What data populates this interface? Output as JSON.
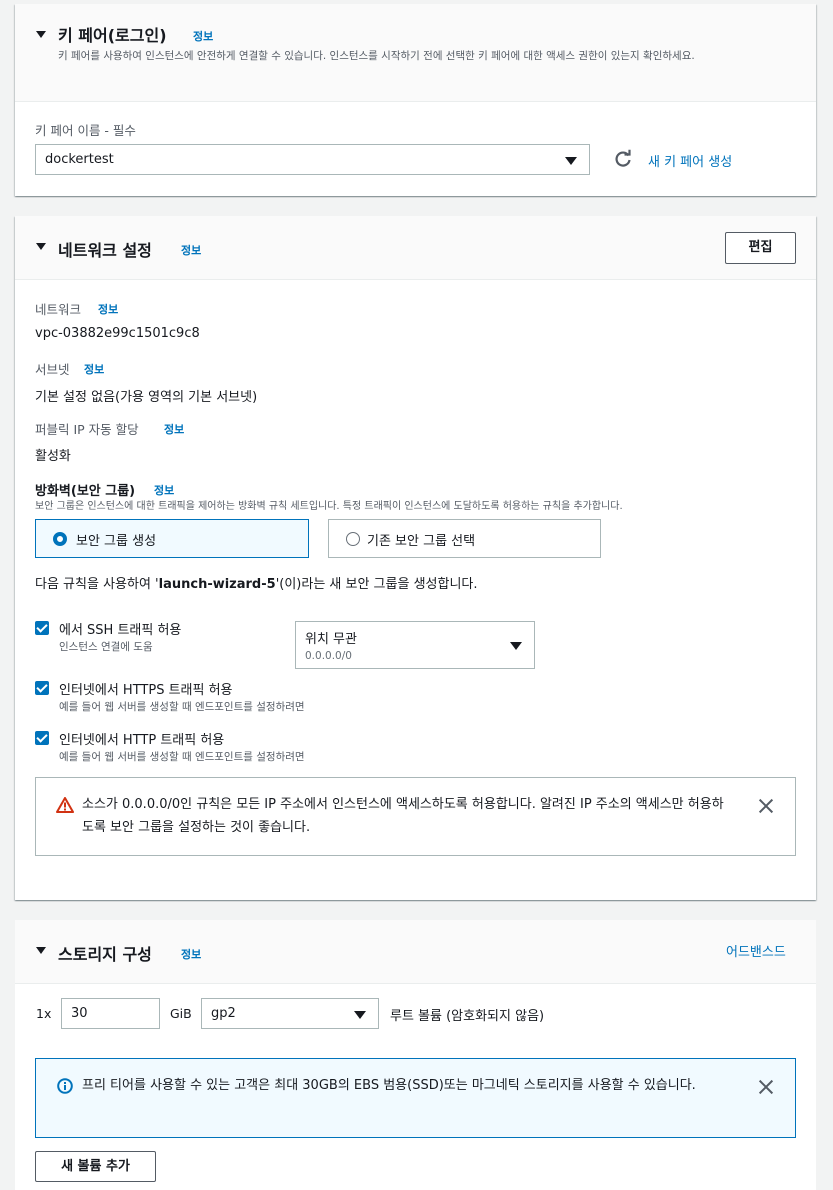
{
  "keypair": {
    "title": "키 페어(로그인)",
    "info": "정보",
    "description": "키 페어를 사용하여 인스턴스에 안전하게 연결할 수 있습니다. 인스턴스를 시작하기 전에 선택한 키 페어에 대한 액세스 권한이 있는지 확인하세요.",
    "name_label": "키 페어 이름 - 필수",
    "selected": "dockertest",
    "create_link": "새 키 페어 생성"
  },
  "network": {
    "title": "네트워크 설정",
    "info": "정보",
    "edit_button": "편집",
    "network_label": "네트워크",
    "network_value": "vpc-03882e99c1501c9c8",
    "subnet_label": "서브넷",
    "subnet_value": "기본 설정 없음(가용 영역의 기본 서브넷)",
    "public_ip_label": "퍼블릭 IP 자동 할당",
    "public_ip_value": "활성화",
    "firewall_label": "방화벽(보안 그룹)",
    "firewall_desc": "보안 그룹은 인스턴스에 대한 트래픽을 제어하는 방화벽 규칙 세트입니다. 특정 트래픽이 인스턴스에 도달하도록 허용하는 규칙을 추가합니다.",
    "radio_create": "보안 그룹 생성",
    "radio_existing": "기존 보안 그룹 선택",
    "rule_note_prefix": "다음 규칙을 사용하여 '",
    "rule_note_name": "launch-wizard-5",
    "rule_note_suffix": "'(이)라는 새 보안 그룹을 생성합니다.",
    "ssh_label": "에서 SSH 트래픽 허용",
    "ssh_sub": "인스턴스 연결에 도움",
    "ssh_source": "위치 무관",
    "ssh_source_sub": "0.0.0.0/0",
    "https_label": "인터넷에서 HTTPS 트래픽 허용",
    "https_sub": "예를 들어 웹 서버를 생성할 때 엔드포인트를 설정하려면",
    "http_label": "인터넷에서 HTTP 트래픽 허용",
    "http_sub": "예를 들어 웹 서버를 생성할 때 엔드포인트를 설정하려면",
    "warning": "소스가 0.0.0.0/0인 규칙은 모든 IP 주소에서 인스턴스에 액세스하도록 허용합니다. 알려진 IP 주소의 액세스만 허용하도록 보안 그룹을 설정하는 것이 좋습니다."
  },
  "storage": {
    "title": "스토리지 구성",
    "info": "정보",
    "advanced_link": "어드밴스드",
    "count_label": "1x",
    "size_value": "30",
    "unit_label": "GiB",
    "volume_type": "gp2",
    "root_label": "루트 볼륨  (암호화되지 않음)",
    "info_alert": "프리 티어를 사용할 수 있는 고객은 최대 30GB의 EBS 범용(SSD)또는 마그네틱 스토리지를 사용할 수 있습니다.",
    "add_volume_button": "새 볼륨 추가"
  },
  "colors": {
    "accent": "#0073bb",
    "warning": "#d13212",
    "text": "#16191f",
    "muted": "#545b64"
  }
}
